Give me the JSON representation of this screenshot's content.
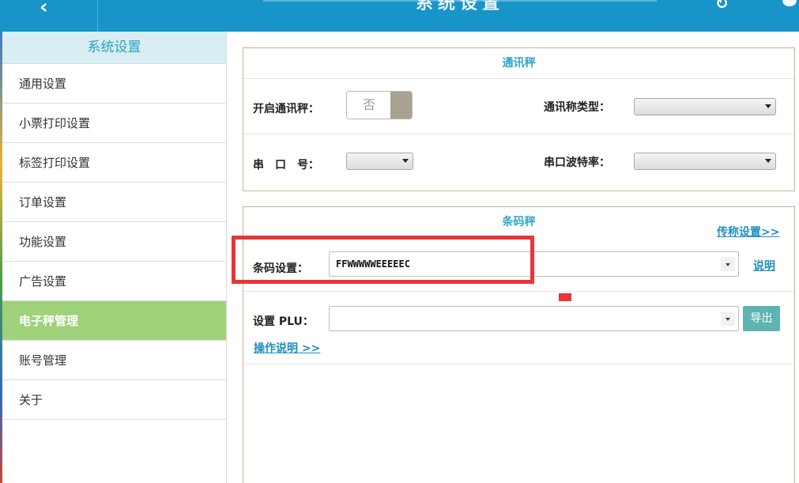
{
  "header": {
    "title": "系统设置"
  },
  "sidebar": {
    "header": "系统设置",
    "items": [
      {
        "label": "通用设置",
        "active": false
      },
      {
        "label": "小票打印设置",
        "active": false
      },
      {
        "label": "标签打印设置",
        "active": false
      },
      {
        "label": "订单设置",
        "active": false
      },
      {
        "label": "功能设置",
        "active": false
      },
      {
        "label": "广告设置",
        "active": false
      },
      {
        "label": "电子秤管理",
        "active": true
      },
      {
        "label": "账号管理",
        "active": false
      },
      {
        "label": "关于",
        "active": false
      }
    ]
  },
  "comm_scale": {
    "title": "通讯秤",
    "enable_label": "开启通讯秤：",
    "enable_value": "否",
    "type_label": "通讯称类型：",
    "port_label": "串　口　号：",
    "baud_label": "串口波特率："
  },
  "barcode_scale": {
    "title": "条码秤",
    "transfer_link": "传称设置>>",
    "barcode_label": "条码设置：",
    "barcode_value": "FFWWWWWEEEEEC",
    "explain_link": "说明",
    "plu_label": "设置 PLU：",
    "plu_value": "",
    "export_button": "导出",
    "guide_link": "操作说明 >>"
  },
  "colors": {
    "topbar": "#1795c9",
    "sidebar_active": "#9fd27a",
    "accent": "#2ea6c6",
    "highlight": "#e8343a"
  }
}
